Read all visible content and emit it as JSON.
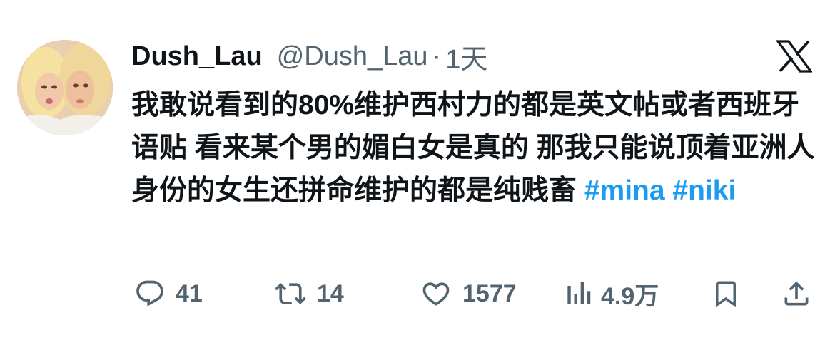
{
  "tweet": {
    "display_name": "Dush_Lau",
    "handle": "@Dush_Lau",
    "separator": "·",
    "time": "1天",
    "text": "我敢说看到的80%维护西村力的都是英文帖或者西班牙语贴 看来某个男的媚白女是真的 那我只能说顶着亚洲人身份的女生还拼命维护的都是纯贱畜",
    "hashtags": [
      "#mina",
      "#niki"
    ],
    "platform_icon": "x-logo-icon"
  },
  "actions": {
    "replies": "41",
    "retweets": "14",
    "likes": "1577",
    "views": "4.9万",
    "icons": [
      "reply-icon",
      "retweet-icon",
      "heart-icon",
      "views-icon",
      "bookmark-icon",
      "share-icon"
    ]
  },
  "colors": {
    "text": "#0f1419",
    "secondary": "#536471",
    "link": "#1d9bf0"
  }
}
